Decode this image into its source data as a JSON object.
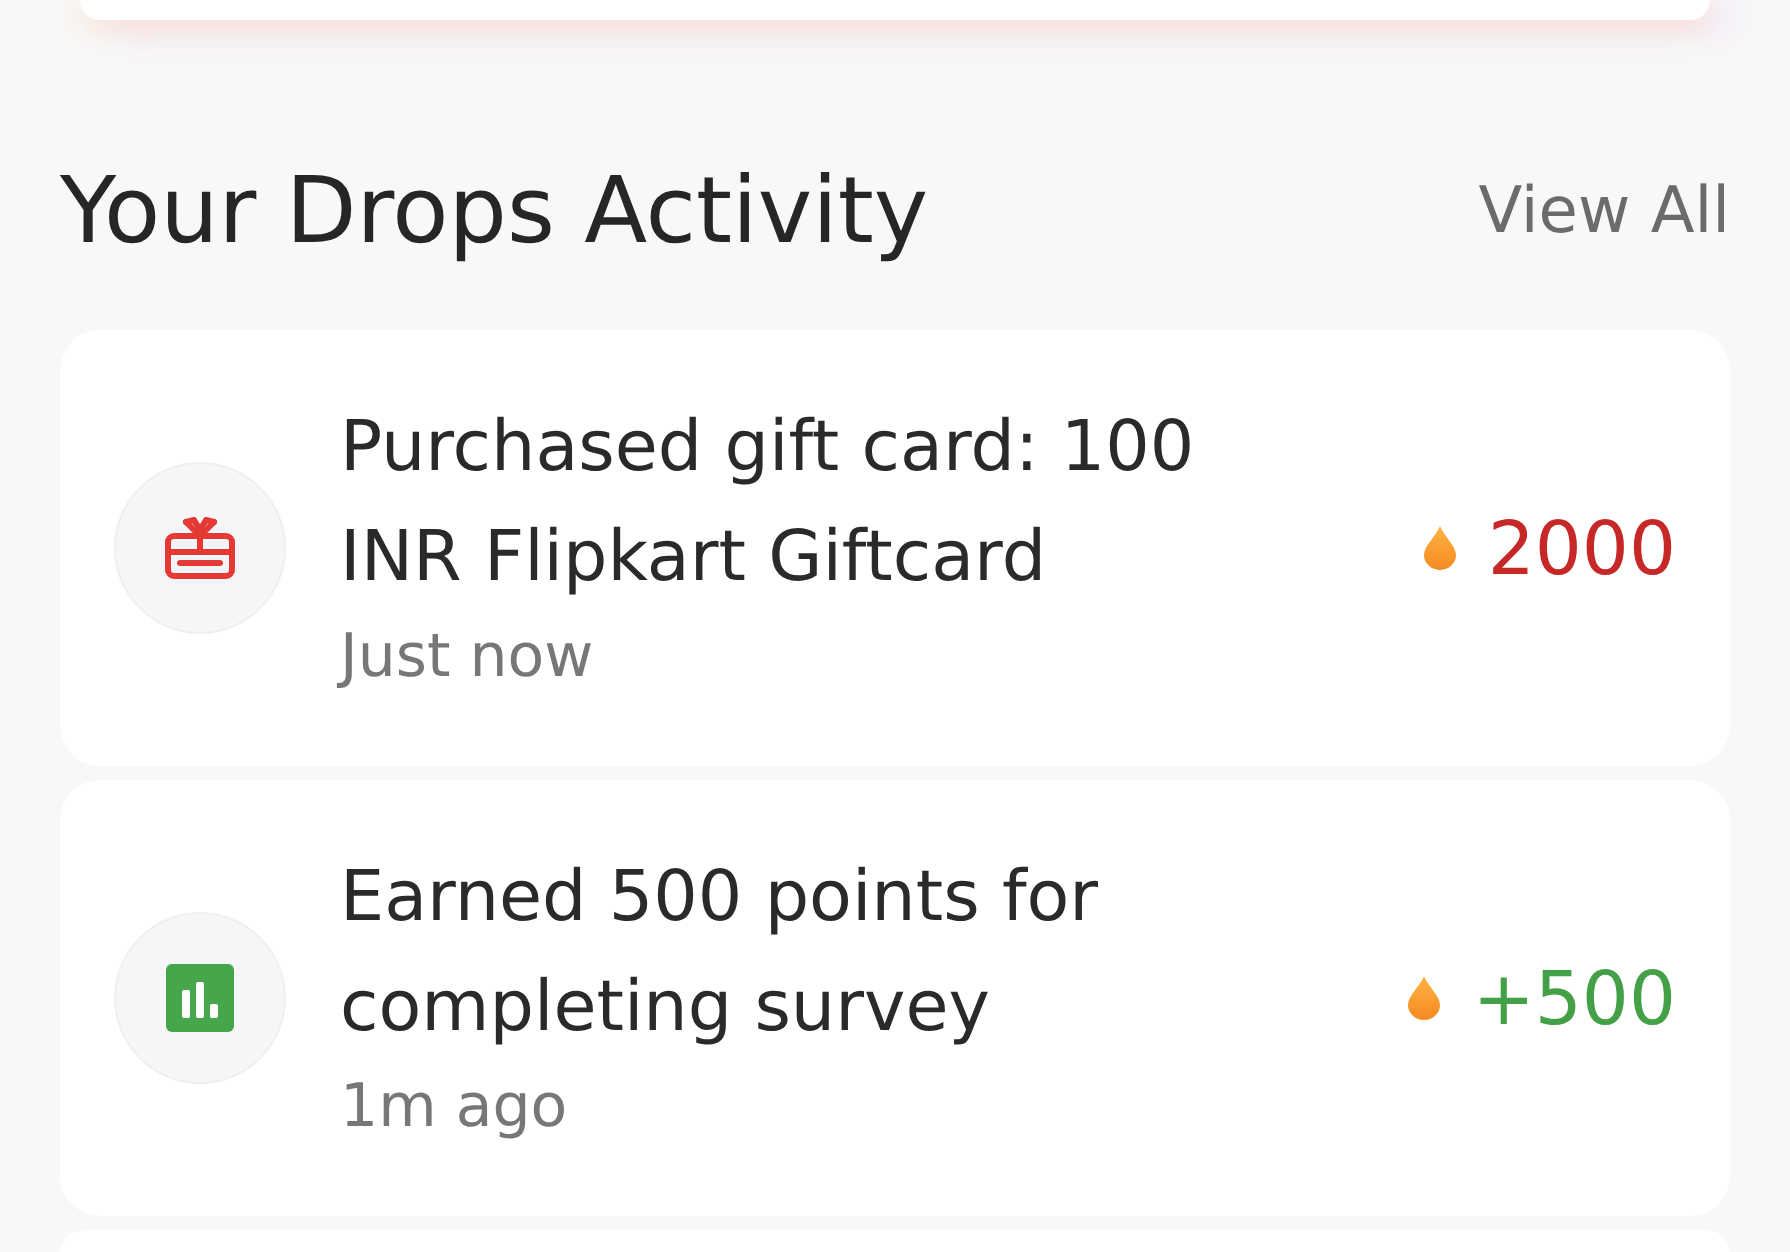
{
  "section": {
    "title": "Your Drops Activity",
    "view_all": "View All"
  },
  "activities": [
    {
      "kind": "spend",
      "description": "Purchased gift card: 100 INR Flipkart Giftcard",
      "time": "Just now",
      "amount": "2000"
    },
    {
      "kind": "earn",
      "description": "Earned 500 points for completing survey",
      "time": "1m ago",
      "amount": "+500"
    }
  ]
}
